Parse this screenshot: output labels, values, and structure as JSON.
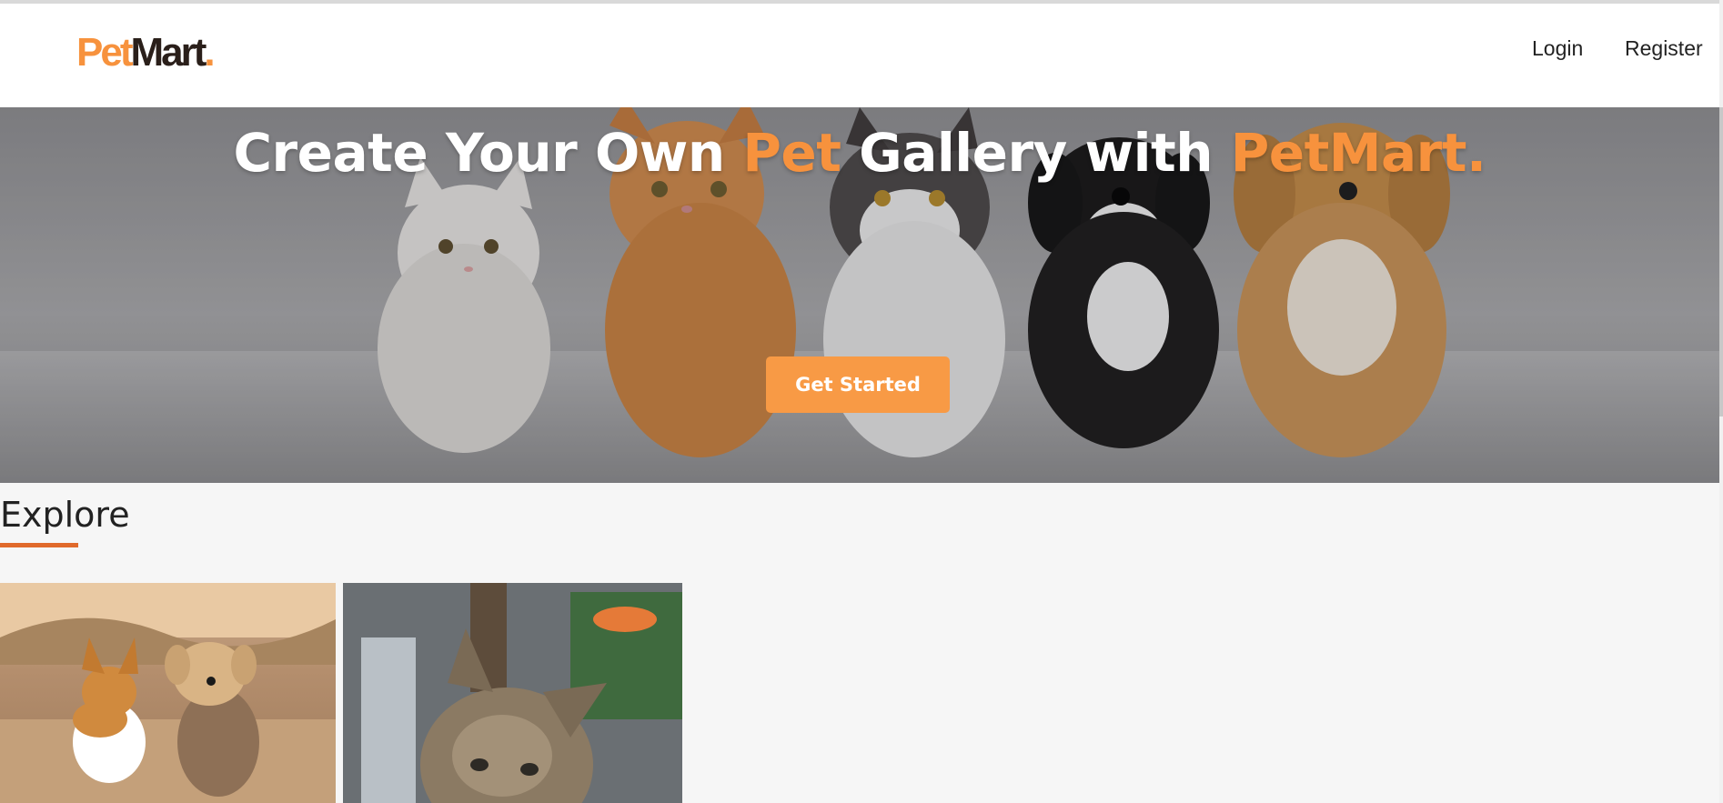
{
  "navbar": {
    "logo": {
      "part1": "Pet",
      "part2": "Mart",
      "dot": "."
    },
    "links": {
      "login": "Login",
      "register": "Register"
    }
  },
  "hero": {
    "title": {
      "part1": "Create Your Own ",
      "accent1": "Pet",
      "part2": " Gallery with ",
      "accent2": "PetMart."
    },
    "cta_label": "Get Started",
    "background_subject": "three cats and two dogs sitting in a row on a floor"
  },
  "explore": {
    "title": "Explore",
    "cards": [
      {
        "subject": "corgi and yorkshire terrier running on a dirt path"
      },
      {
        "subject": "tabby kitten close-up"
      }
    ]
  },
  "colors": {
    "accent": "#f7923d",
    "button": "#f89a45",
    "underline": "#e06a2b",
    "text_dark": "#222222"
  }
}
